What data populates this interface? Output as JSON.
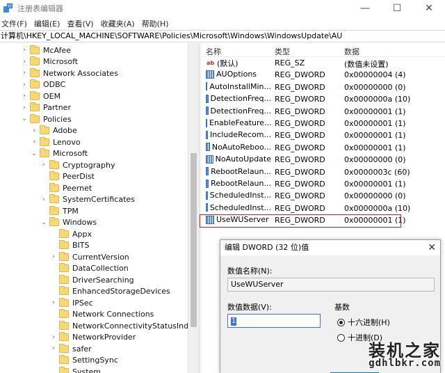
{
  "window": {
    "title": "注册表编辑器",
    "minimize_glyph": "—",
    "maximize_glyph": "☐",
    "close_glyph": "✕"
  },
  "menu": [
    "文件(F)",
    "编辑(E)",
    "查看(V)",
    "收藏夹(A)",
    "帮助(H)"
  ],
  "address": "计算机\\HKEY_LOCAL_MACHINE\\SOFTWARE\\Policies\\Microsoft\\Windows\\WindowsUpdate\\AU",
  "tree": [
    {
      "label": "McAfee",
      "level": 0,
      "expander": "›"
    },
    {
      "label": "Microsoft",
      "level": 0,
      "expander": "›"
    },
    {
      "label": "Network Associates",
      "level": 0,
      "expander": "›"
    },
    {
      "label": "ODBC",
      "level": 0,
      "expander": "›"
    },
    {
      "label": "OEM",
      "level": 0,
      "expander": "›"
    },
    {
      "label": "Partner",
      "level": 0,
      "expander": "›"
    },
    {
      "label": "Policies",
      "level": 0,
      "expander": "⌄"
    },
    {
      "label": "Adobe",
      "level": 1,
      "expander": "›"
    },
    {
      "label": "Lenovo",
      "level": 1,
      "expander": "›"
    },
    {
      "label": "Microsoft",
      "level": 1,
      "expander": "⌄"
    },
    {
      "label": "Cryptography",
      "level": 2,
      "expander": "›"
    },
    {
      "label": "PeerDist",
      "level": 2,
      "expander": ""
    },
    {
      "label": "Peernet",
      "level": 2,
      "expander": ""
    },
    {
      "label": "SystemCertificates",
      "level": 2,
      "expander": "›"
    },
    {
      "label": "TPM",
      "level": 2,
      "expander": ""
    },
    {
      "label": "Windows",
      "level": 2,
      "expander": "⌄"
    },
    {
      "label": "Appx",
      "level": 3,
      "expander": ""
    },
    {
      "label": "BITS",
      "level": 3,
      "expander": ""
    },
    {
      "label": "CurrentVersion",
      "level": 3,
      "expander": "›"
    },
    {
      "label": "DataCollection",
      "level": 3,
      "expander": ""
    },
    {
      "label": "DriverSearching",
      "level": 3,
      "expander": ""
    },
    {
      "label": "EnhancedStorageDevices",
      "level": 3,
      "expander": ""
    },
    {
      "label": "IPSec",
      "level": 3,
      "expander": "›"
    },
    {
      "label": "Network Connections",
      "level": 3,
      "expander": ""
    },
    {
      "label": "NetworkConnectivityStatusIndicator",
      "level": 3,
      "expander": ""
    },
    {
      "label": "NetworkProvider",
      "level": 3,
      "expander": "›"
    },
    {
      "label": "safer",
      "level": 3,
      "expander": "›"
    },
    {
      "label": "SettingSync",
      "level": 3,
      "expander": ""
    },
    {
      "label": "System",
      "level": 3,
      "expander": ""
    }
  ],
  "list": {
    "columns": {
      "name": "名称",
      "type": "类型",
      "data": "数据"
    },
    "rows": [
      {
        "icon": "string-value-icon",
        "name": "(默认)",
        "type": "REG_SZ",
        "data": "(数值未设置)"
      },
      {
        "icon": "dword-value-icon",
        "name": "AUOptions",
        "type": "REG_DWORD",
        "data": "0x00000004 (4)"
      },
      {
        "icon": "dword-value-icon",
        "name": "AutoInstallMin...",
        "type": "REG_DWORD",
        "data": "0x00000000 (0)"
      },
      {
        "icon": "dword-value-icon",
        "name": "DetectionFreq...",
        "type": "REG_DWORD",
        "data": "0x0000000a (10)"
      },
      {
        "icon": "dword-value-icon",
        "name": "DetectionFreq...",
        "type": "REG_DWORD",
        "data": "0x00000001 (1)"
      },
      {
        "icon": "dword-value-icon",
        "name": "EnableFeature...",
        "type": "REG_DWORD",
        "data": "0x00000001 (1)"
      },
      {
        "icon": "dword-value-icon",
        "name": "IncludeRecom...",
        "type": "REG_DWORD",
        "data": "0x00000001 (1)"
      },
      {
        "icon": "dword-value-icon",
        "name": "NoAutoReboo...",
        "type": "REG_DWORD",
        "data": "0x00000001 (1)"
      },
      {
        "icon": "dword-value-icon",
        "name": "NoAutoUpdate",
        "type": "REG_DWORD",
        "data": "0x00000000 (0)"
      },
      {
        "icon": "dword-value-icon",
        "name": "RebootRelaun...",
        "type": "REG_DWORD",
        "data": "0x0000003c (60)"
      },
      {
        "icon": "dword-value-icon",
        "name": "RebootRelaun...",
        "type": "REG_DWORD",
        "data": "0x00000001 (1)"
      },
      {
        "icon": "dword-value-icon",
        "name": "ScheduledInst...",
        "type": "REG_DWORD",
        "data": "0x00000000 (0)"
      },
      {
        "icon": "dword-value-icon",
        "name": "ScheduledInst...",
        "type": "REG_DWORD",
        "data": "0x0000000a (10)"
      },
      {
        "icon": "dword-value-icon",
        "name": "UseWUServer",
        "type": "REG_DWORD",
        "data": "0x00000001 (1)"
      }
    ]
  },
  "highlight_color": "#c8202a",
  "dialog": {
    "title": "编辑 DWORD (32 位)值",
    "close_glyph": "✕",
    "value_name_label": "数值名称(N):",
    "value_name": "UseWUServer",
    "value_data_label": "数值数据(V):",
    "value_data": "1",
    "base_label": "基数",
    "hex_label": "十六进制(H)",
    "dec_label": "十进制(D)",
    "selected_base": "hex"
  },
  "watermark": {
    "text": "装机之家",
    "url": "gdhlbkr.com"
  }
}
